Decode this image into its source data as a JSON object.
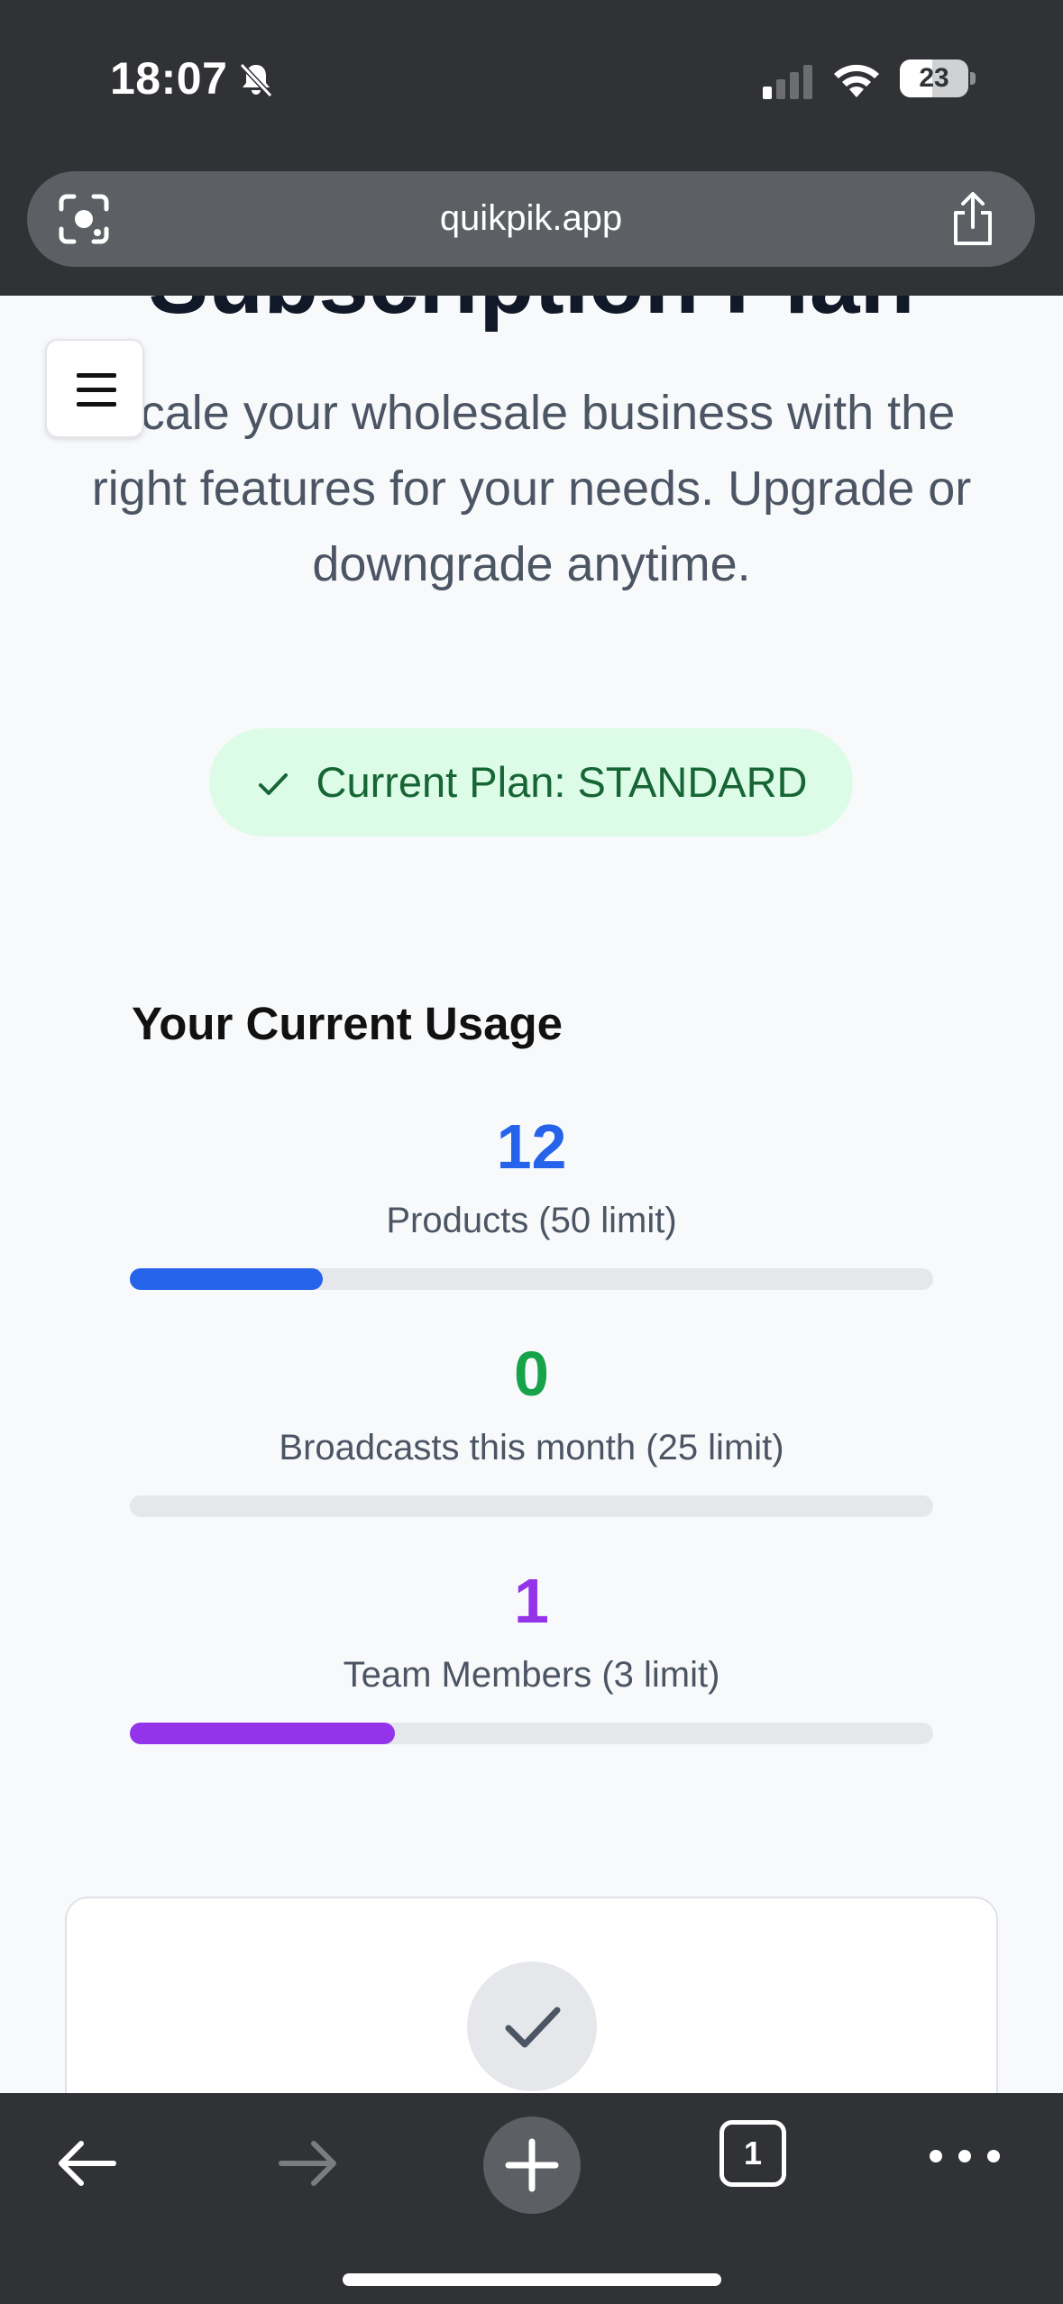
{
  "status_bar": {
    "time": "18:07",
    "battery_level": "23"
  },
  "browser": {
    "url": "quikpik.app"
  },
  "page": {
    "title": "Subscription Plan",
    "subtitle": "Scale your wholesale business with the right features for your needs. Upgrade or downgrade anytime.",
    "current_plan_label": "Current Plan: STANDARD"
  },
  "usage": {
    "title": "Your Current Usage",
    "items": [
      {
        "value": "12",
        "label": "Products (50 limit)",
        "fraction": 0.24,
        "color": "#2563eb"
      },
      {
        "value": "0",
        "label": "Broadcasts this month (25 limit)",
        "fraction": 0,
        "color": "#16a34a"
      },
      {
        "value": "1",
        "label": "Team Members (3 limit)",
        "fraction": 0.33,
        "color": "#9333ea"
      }
    ]
  },
  "toolbar": {
    "tab_count": "1"
  },
  "colors": {
    "chrome": "#303235",
    "accent_blue": "#2563eb",
    "accent_green": "#16a34a",
    "accent_purple": "#9333ea",
    "badge_bg": "#dcfce7"
  },
  "icons": [
    "bell-slash-icon",
    "signal-icon",
    "wifi-icon",
    "battery-icon",
    "lens-icon",
    "share-icon",
    "menu-icon",
    "check-icon",
    "back-arrow-icon",
    "forward-arrow-icon",
    "plus-icon",
    "tabs-icon",
    "more-icon"
  ]
}
